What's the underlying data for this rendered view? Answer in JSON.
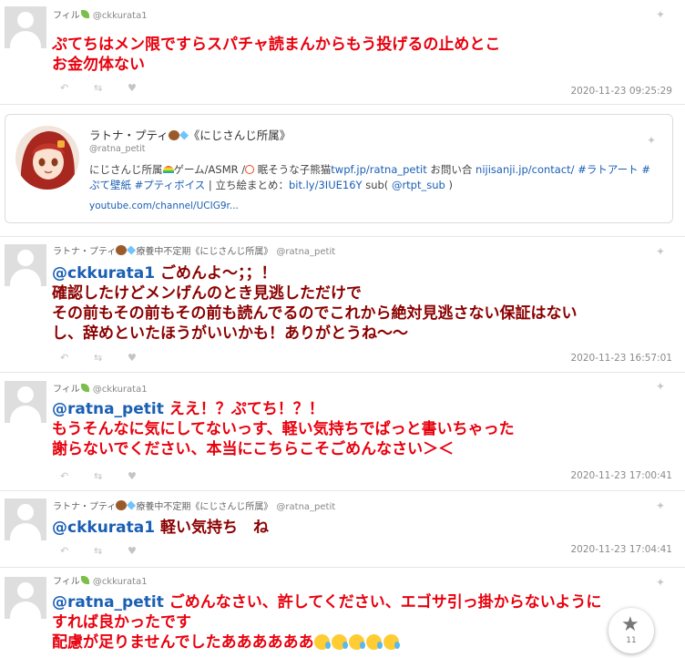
{
  "tweets": [
    {
      "name": "フィル",
      "handle": "@ckkurata1",
      "line1": "ぷてちはメン限ですらスパチャ読まんからもう投げるの止めとこ",
      "line2": "お金勿体ない",
      "timestamp": "2020-11-23 09:25:29"
    },
    {
      "name": "ラトナ・プティ",
      "name_suffix": "療養中不定期《にじさんじ所属》",
      "handle": "@ratna_petit",
      "mention": "@ckkurata1",
      "line1_rest": " ごめんよ～；；！",
      "line2": "確認したけどメンげんのとき見逃しただけで",
      "line3": "その前もその前もその前も読んでるのでこれから絶対見逃さない保証はない",
      "line4": "し、辞めといたほうがいいかも！ありがとうね～～",
      "timestamp": "2020-11-23 16:57:01"
    },
    {
      "name": "フィル",
      "handle": "@ckkurata1",
      "mention": "@ratna_petit",
      "line1_rest": " ええ！？ぷてち！？！",
      "line2": "もうそんなに気にしてないっす、軽い気持ちでぱっと書いちゃった",
      "line3": "謝らないでください、本当にこちらこそごめんなさい＞＜",
      "timestamp": "2020-11-23 17:00:41"
    },
    {
      "name": "ラトナ・プティ",
      "name_suffix": "療養中不定期《にじさんじ所属》",
      "handle": "@ratna_petit",
      "mention": "@ckkurata1",
      "line1_rest": " 軽い気持ち　ね",
      "timestamp": "2020-11-23 17:04:41"
    },
    {
      "name": "フィル",
      "handle": "@ckkurata1",
      "mention": "@ratna_petit",
      "line1_rest": " ごめんなさい、許してください、エゴサ引っ掛からないように",
      "line2": "すれば良かったです",
      "line3": "配慮が足りませんでしたああああああ"
    }
  ],
  "profile_card": {
    "name": "ラトナ・プティ",
    "name_suffix": "《にじさんじ所属》",
    "handle": "@ratna_petit",
    "bio_1a": "にじさんじ所属",
    "bio_1b": "ゲーム/ASMR /",
    "bio_1c": " 眠そうな子熊猫",
    "bio_link1": "twpf.jp/ratna_petit",
    "bio_1d": " お問い合 ",
    "bio_link2": "nijisanji.jp/contact/",
    "bio_link3": " #ラトアート",
    "bio_link4": " #",
    "bio_link5": "ぷて壁紙",
    "bio_link6": " #プティボイス",
    "bio_2b": " | 立ち絵まとめ：",
    "bio_link7": "bit.ly/3IUE16Y",
    "bio_2c": " sub( ",
    "bio_link8": "@rtpt_sub",
    "bio_2d": " )",
    "url": "youtube.com/channel/UCIG9r..."
  },
  "icons": {
    "bird": "twitter-bird-icon",
    "reply": "reply-icon",
    "retweet": "retweet-icon",
    "like": "heart-icon",
    "star": "star-icon"
  },
  "fab": {
    "count": "11"
  },
  "colors": {
    "tweet_red": "#e8000d",
    "reply_dark": "#8b0000",
    "mention_blue": "#1a5fb4"
  }
}
